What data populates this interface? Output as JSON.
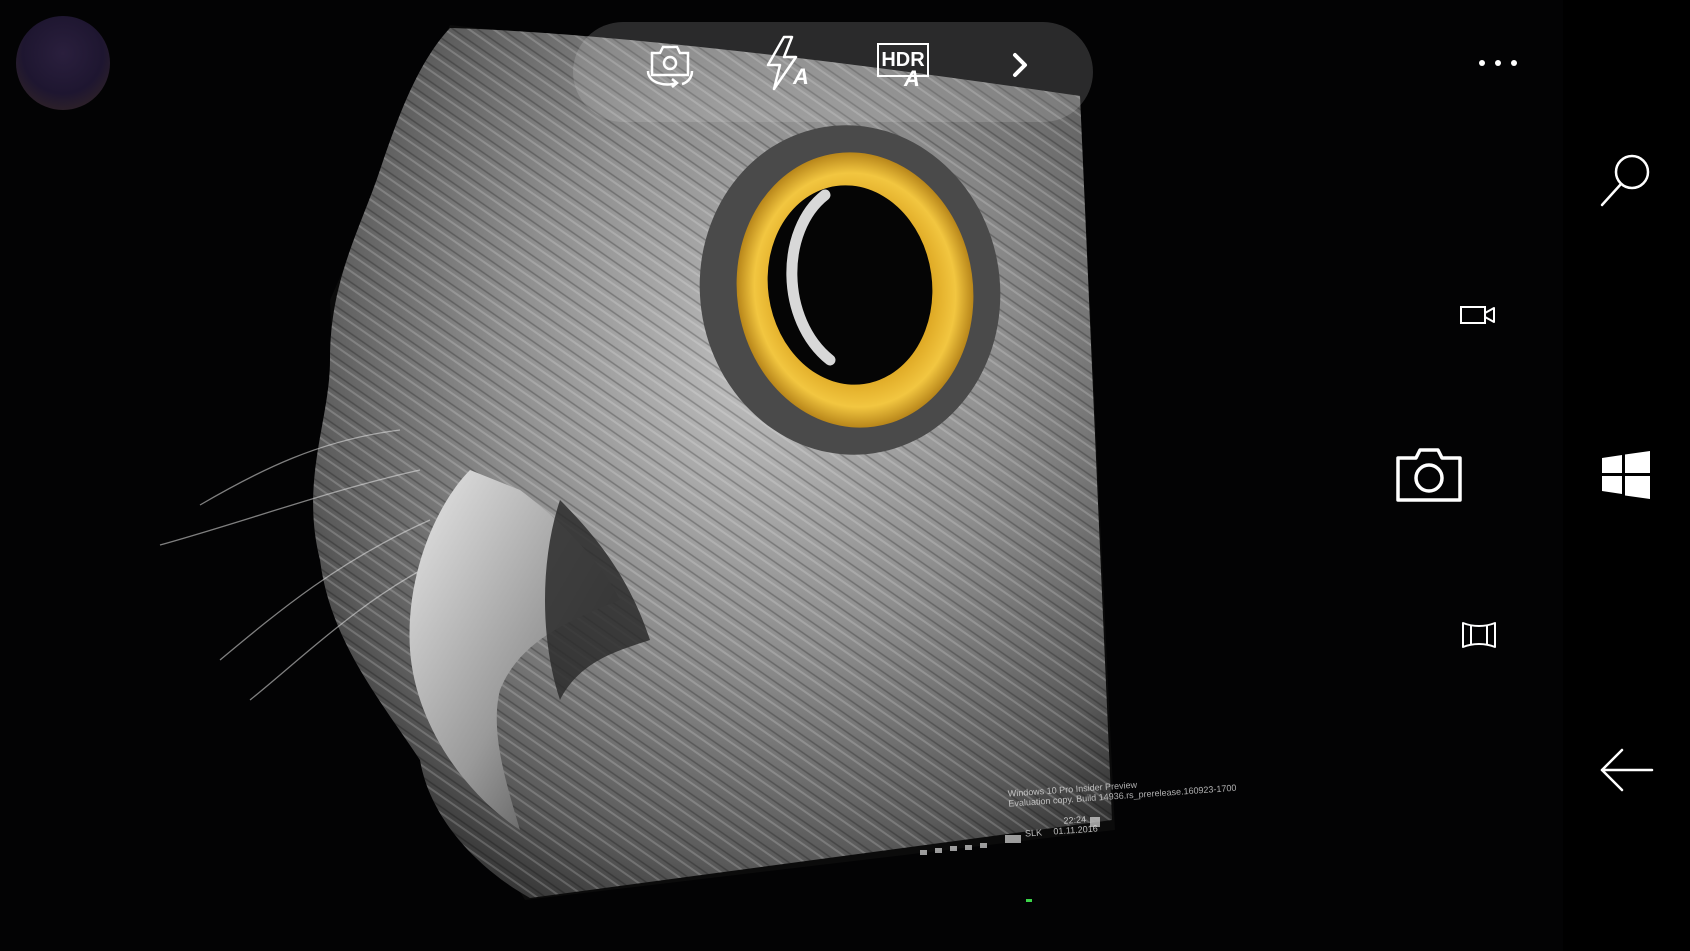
{
  "app": {
    "name": "Camera",
    "accent": "#ffffff"
  },
  "top_controls": [
    {
      "id": "switch-camera",
      "icon": "camera-switch-icon"
    },
    {
      "id": "flash",
      "icon": "flash-auto-icon",
      "badge": "A"
    },
    {
      "id": "hdr",
      "icon": "hdr-auto-icon",
      "label": "HDR",
      "badge": "A"
    },
    {
      "id": "more-controls",
      "icon": "chevron-right-icon"
    }
  ],
  "side_controls": [
    {
      "id": "video-mode",
      "icon": "video-camera-icon"
    },
    {
      "id": "capture-photo",
      "icon": "camera-icon"
    },
    {
      "id": "panorama-mode",
      "icon": "panorama-icon"
    }
  ],
  "more_menu": {
    "icon": "ellipsis-icon",
    "label": "..."
  },
  "thumbnail": {
    "icon": "last-photo-thumbnail"
  },
  "nav": [
    {
      "id": "search",
      "icon": "search-icon"
    },
    {
      "id": "start",
      "icon": "windows-logo-icon"
    },
    {
      "id": "back",
      "icon": "back-arrow-icon"
    }
  ],
  "viewfinder_screen_text": {
    "line1": "Windows 10 Pro Insider Preview",
    "line2": "Evaluation copy. Build 14936.rs_prerelease.160923-1700",
    "time": "22:24",
    "date": "01.11.2016",
    "lang": "SLK"
  }
}
